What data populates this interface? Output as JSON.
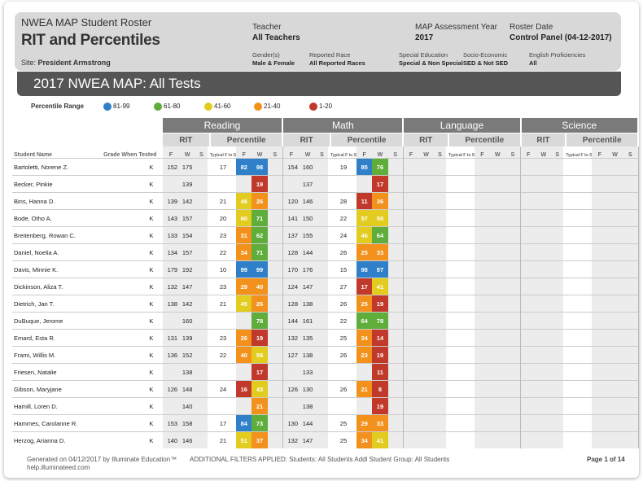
{
  "header": {
    "title_line1": "NWEA MAP Student Roster",
    "title_line2": "RIT and Percentiles",
    "site_label": "Site:",
    "site_value": "President Armstrong",
    "teacher_label": "Teacher",
    "teacher_value": "All Teachers",
    "year_label": "MAP Assessment Year",
    "year_value": "2017",
    "roster_date_label": "Roster Date",
    "roster_date_value": "Control Panel (04-12-2017)",
    "filters": [
      {
        "label": "Gender(s)",
        "value": "Male & Female"
      },
      {
        "label": "Reported Race",
        "value": "All Reported Races"
      },
      {
        "label": "Special Education",
        "value": "Special & Non Special"
      },
      {
        "label": "Socio-Economic",
        "value": "SED & Not SED"
      },
      {
        "label": "English Proficiencies",
        "value": "All"
      }
    ]
  },
  "banner": "2017 NWEA MAP: All Tests",
  "legend": {
    "title": "Percentile Range",
    "items": [
      {
        "label": "81-99",
        "color": "#2f80c9"
      },
      {
        "label": "61-80",
        "color": "#5fad3a"
      },
      {
        "label": "41-60",
        "color": "#e2cc1f"
      },
      {
        "label": "21-40",
        "color": "#f2921c"
      },
      {
        "label": "1-20",
        "color": "#c0392b"
      }
    ]
  },
  "table": {
    "subjects": [
      "Reading",
      "Math",
      "Language",
      "Science"
    ],
    "group_rit": "RIT",
    "group_pct": "Percentile",
    "col_student": "Student Name",
    "col_grade": "Grade When Tested",
    "terms": [
      "F",
      "W",
      "S"
    ],
    "typical_label": "Typical F to S",
    "rows": [
      {
        "name": "Bartoletti, Norene Z.",
        "grade": "K",
        "r_rit": [
          "152",
          "175",
          ""
        ],
        "r_typ": "17",
        "r_pct": [
          [
            "82",
            "blue"
          ],
          [
            "98",
            "blue"
          ],
          [
            "",
            ""
          ]
        ],
        "m_rit": [
          "154",
          "160",
          ""
        ],
        "m_typ": "19",
        "m_pct": [
          [
            "85",
            "blue"
          ],
          [
            "76",
            "green"
          ],
          [
            "",
            ""
          ]
        ]
      },
      {
        "name": "Becker, Pinkie",
        "grade": "K",
        "r_rit": [
          "",
          "139",
          ""
        ],
        "r_typ": "",
        "r_pct": [
          [
            "",
            ""
          ],
          [
            "19",
            "red"
          ],
          [
            "",
            ""
          ]
        ],
        "m_rit": [
          "",
          "137",
          ""
        ],
        "m_typ": "",
        "m_pct": [
          [
            "",
            ""
          ],
          [
            "17",
            "red"
          ],
          [
            "",
            ""
          ]
        ]
      },
      {
        "name": "Bins, Hanna D.",
        "grade": "K",
        "r_rit": [
          "139",
          "142",
          ""
        ],
        "r_typ": "21",
        "r_pct": [
          [
            "48",
            "yellow"
          ],
          [
            "26",
            "orange"
          ],
          [
            "",
            ""
          ]
        ],
        "m_rit": [
          "120",
          "146",
          ""
        ],
        "m_typ": "28",
        "m_pct": [
          [
            "11",
            "red"
          ],
          [
            "36",
            "orange"
          ],
          [
            "",
            ""
          ]
        ]
      },
      {
        "name": "Bode, Otho A.",
        "grade": "K",
        "r_rit": [
          "143",
          "157",
          ""
        ],
        "r_typ": "20",
        "r_pct": [
          [
            "60",
            "yellow"
          ],
          [
            "71",
            "green"
          ],
          [
            "",
            ""
          ]
        ],
        "m_rit": [
          "141",
          "150",
          ""
        ],
        "m_typ": "22",
        "m_pct": [
          [
            "57",
            "yellow"
          ],
          [
            "50",
            "yellow"
          ],
          [
            "",
            ""
          ]
        ]
      },
      {
        "name": "Breitenberg, Rowan C.",
        "grade": "K",
        "r_rit": [
          "133",
          "154",
          ""
        ],
        "r_typ": "23",
        "r_pct": [
          [
            "31",
            "orange"
          ],
          [
            "62",
            "green"
          ],
          [
            "",
            ""
          ]
        ],
        "m_rit": [
          "137",
          "155",
          ""
        ],
        "m_typ": "24",
        "m_pct": [
          [
            "46",
            "yellow"
          ],
          [
            "64",
            "green"
          ],
          [
            "",
            ""
          ]
        ]
      },
      {
        "name": "Daniel, Noelia A.",
        "grade": "K",
        "r_rit": [
          "134",
          "157",
          ""
        ],
        "r_typ": "22",
        "r_pct": [
          [
            "34",
            "orange"
          ],
          [
            "71",
            "green"
          ],
          [
            "",
            ""
          ]
        ],
        "m_rit": [
          "128",
          "144",
          ""
        ],
        "m_typ": "26",
        "m_pct": [
          [
            "25",
            "orange"
          ],
          [
            "33",
            "orange"
          ],
          [
            "",
            ""
          ]
        ]
      },
      {
        "name": "Davis, Minnie K.",
        "grade": "K",
        "r_rit": [
          "179",
          "192",
          ""
        ],
        "r_typ": "10",
        "r_pct": [
          [
            "99",
            "blue"
          ],
          [
            "99",
            "blue"
          ],
          [
            "",
            ""
          ]
        ],
        "m_rit": [
          "170",
          "176",
          ""
        ],
        "m_typ": "15",
        "m_pct": [
          [
            "98",
            "blue"
          ],
          [
            "97",
            "blue"
          ],
          [
            "",
            ""
          ]
        ]
      },
      {
        "name": "Dickinson, Aliza T.",
        "grade": "K",
        "r_rit": [
          "132",
          "147",
          ""
        ],
        "r_typ": "23",
        "r_pct": [
          [
            "29",
            "orange"
          ],
          [
            "40",
            "orange"
          ],
          [
            "",
            ""
          ]
        ],
        "m_rit": [
          "124",
          "147",
          ""
        ],
        "m_typ": "27",
        "m_pct": [
          [
            "17",
            "red"
          ],
          [
            "41",
            "yellow"
          ],
          [
            "",
            ""
          ]
        ]
      },
      {
        "name": "Dietrich, Jan T.",
        "grade": "K",
        "r_rit": [
          "138",
          "142",
          ""
        ],
        "r_typ": "21",
        "r_pct": [
          [
            "45",
            "yellow"
          ],
          [
            "26",
            "orange"
          ],
          [
            "",
            ""
          ]
        ],
        "m_rit": [
          "128",
          "138",
          ""
        ],
        "m_typ": "26",
        "m_pct": [
          [
            "25",
            "orange"
          ],
          [
            "19",
            "red"
          ],
          [
            "",
            ""
          ]
        ]
      },
      {
        "name": "DuBuque, Jerome",
        "grade": "K",
        "r_rit": [
          "",
          "160",
          ""
        ],
        "r_typ": "",
        "r_pct": [
          [
            "",
            ""
          ],
          [
            "78",
            "green"
          ],
          [
            "",
            ""
          ]
        ],
        "m_rit": [
          "144",
          "161",
          ""
        ],
        "m_typ": "22",
        "m_pct": [
          [
            "64",
            "green"
          ],
          [
            "78",
            "green"
          ],
          [
            "",
            ""
          ]
        ]
      },
      {
        "name": "Emard, Esta R.",
        "grade": "K",
        "r_rit": [
          "131",
          "139",
          ""
        ],
        "r_typ": "23",
        "r_pct": [
          [
            "26",
            "orange"
          ],
          [
            "19",
            "red"
          ],
          [
            "",
            ""
          ]
        ],
        "m_rit": [
          "132",
          "135",
          ""
        ],
        "m_typ": "25",
        "m_pct": [
          [
            "34",
            "orange"
          ],
          [
            "14",
            "red"
          ],
          [
            "",
            ""
          ]
        ]
      },
      {
        "name": "Frami, Willis M.",
        "grade": "K",
        "r_rit": [
          "136",
          "152",
          ""
        ],
        "r_typ": "22",
        "r_pct": [
          [
            "40",
            "orange"
          ],
          [
            "56",
            "yellow"
          ],
          [
            "",
            ""
          ]
        ],
        "m_rit": [
          "127",
          "138",
          ""
        ],
        "m_typ": "26",
        "m_pct": [
          [
            "23",
            "orange"
          ],
          [
            "19",
            "red"
          ],
          [
            "",
            ""
          ]
        ]
      },
      {
        "name": "Friesen, Natalie",
        "grade": "K",
        "r_rit": [
          "",
          "138",
          ""
        ],
        "r_typ": "",
        "r_pct": [
          [
            "",
            ""
          ],
          [
            "17",
            "red"
          ],
          [
            "",
            ""
          ]
        ],
        "m_rit": [
          "",
          "133",
          ""
        ],
        "m_typ": "",
        "m_pct": [
          [
            "",
            ""
          ],
          [
            "11",
            "red"
          ],
          [
            "",
            ""
          ]
        ]
      },
      {
        "name": "Gibson, Maryjane",
        "grade": "K",
        "r_rit": [
          "126",
          "148",
          ""
        ],
        "r_typ": "24",
        "r_pct": [
          [
            "16",
            "red"
          ],
          [
            "43",
            "yellow"
          ],
          [
            "",
            ""
          ]
        ],
        "m_rit": [
          "126",
          "130",
          ""
        ],
        "m_typ": "26",
        "m_pct": [
          [
            "21",
            "orange"
          ],
          [
            "8",
            "red"
          ],
          [
            "",
            ""
          ]
        ]
      },
      {
        "name": "Hamill, Loren D.",
        "grade": "K",
        "r_rit": [
          "",
          "140",
          ""
        ],
        "r_typ": "",
        "r_pct": [
          [
            "",
            ""
          ],
          [
            "21",
            "orange"
          ],
          [
            "",
            ""
          ]
        ],
        "m_rit": [
          "",
          "138",
          ""
        ],
        "m_typ": "",
        "m_pct": [
          [
            "",
            ""
          ],
          [
            "19",
            "red"
          ],
          [
            "",
            ""
          ]
        ]
      },
      {
        "name": "Hammes, Carolanne R.",
        "grade": "K",
        "r_rit": [
          "153",
          "158",
          ""
        ],
        "r_typ": "17",
        "r_pct": [
          [
            "84",
            "blue"
          ],
          [
            "73",
            "green"
          ],
          [
            "",
            ""
          ]
        ],
        "m_rit": [
          "130",
          "144",
          ""
        ],
        "m_typ": "25",
        "m_pct": [
          [
            "29",
            "orange"
          ],
          [
            "33",
            "orange"
          ],
          [
            "",
            ""
          ]
        ]
      },
      {
        "name": "Herzog, Arianna D.",
        "grade": "K",
        "r_rit": [
          "140",
          "146",
          ""
        ],
        "r_typ": "21",
        "r_pct": [
          [
            "51",
            "yellow"
          ],
          [
            "37",
            "orange"
          ],
          [
            "",
            ""
          ]
        ],
        "m_rit": [
          "132",
          "147",
          ""
        ],
        "m_typ": "25",
        "m_pct": [
          [
            "34",
            "orange"
          ],
          [
            "41",
            "yellow"
          ],
          [
            "",
            ""
          ]
        ]
      }
    ]
  },
  "footer": {
    "generated": "Generated on 04/12/2017 by Illuminate Education™",
    "help": "help.illuminateed.com",
    "filters": "ADDITIONAL FILTERS APPLIED:  Students: All Students   Addl Student Group: All Students",
    "page": "Page 1 of 14"
  }
}
